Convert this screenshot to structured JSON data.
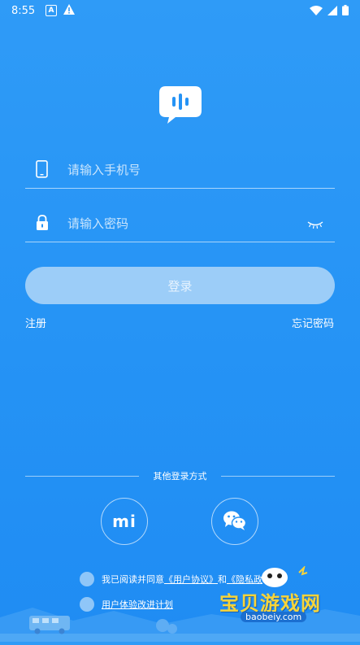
{
  "status_bar": {
    "time": "8:55",
    "a_icon_letter": "A",
    "icons": [
      "a-notification-icon",
      "warning-icon",
      "wifi-icon",
      "signal-icon",
      "battery-icon"
    ]
  },
  "login": {
    "phone_placeholder": "请输入手机号",
    "password_placeholder": "请输入密码",
    "login_button": "登录",
    "register_link": "注册",
    "forgot_link": "忘记密码"
  },
  "other_login": {
    "label": "其他登录方式",
    "xiaomi_mark": "mi",
    "buttons": [
      "xiaomi-icon",
      "wechat-icon"
    ]
  },
  "agreement": {
    "prefix": "我已阅读并同意",
    "user_agreement": "《用户协议》",
    "and": "和",
    "privacy_partial": "《隐私政",
    "ux_plan": "用户体验改进计划"
  },
  "watermark": {
    "title": "宝贝游戏网",
    "url": "baobeiy.com"
  },
  "colors": {
    "background": "#2593f5",
    "button_disabled": "#9ccdf8",
    "radio": "#8fc6f8",
    "watermark_yellow": "#f6d43a"
  }
}
